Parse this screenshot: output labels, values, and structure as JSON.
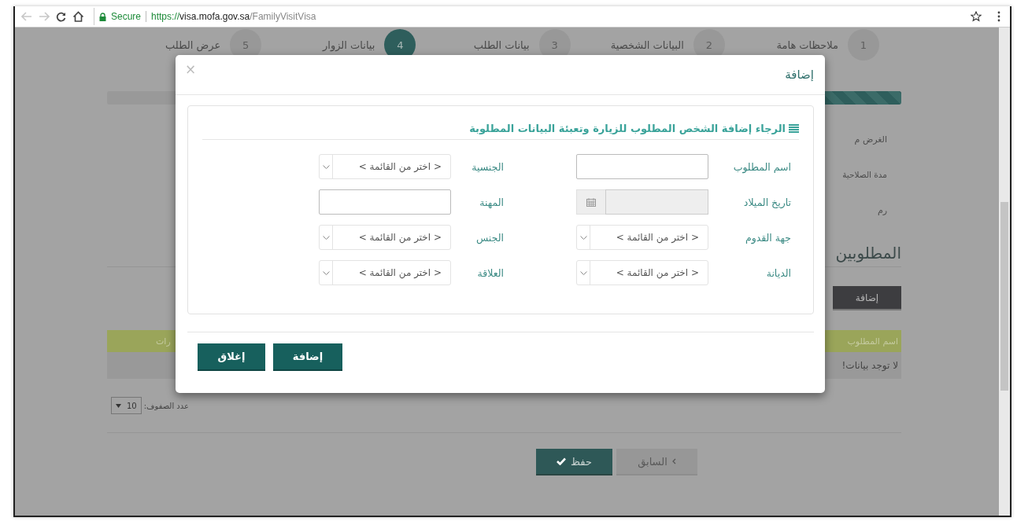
{
  "browser": {
    "secure_label": "Secure",
    "url": {
      "scheme": "https://",
      "host": "visa.mofa.gov.sa",
      "path": "/FamilyVisitVisa"
    }
  },
  "steps": [
    {
      "number": "1",
      "label": "ملاحظات هامة",
      "selected": false
    },
    {
      "number": "2",
      "label": "البيانات الشخصية",
      "selected": false
    },
    {
      "number": "3",
      "label": "بيانات الطلب",
      "selected": false
    },
    {
      "number": "4",
      "label": "بيانات الزوار",
      "selected": true
    },
    {
      "number": "5",
      "label": "عرض الطلب",
      "selected": false
    }
  ],
  "progress": {
    "level": 0.8
  },
  "info_lines": [
    "الغرض م",
    "مدة الصلاحية",
    "رم"
  ],
  "section_title": "المطلوبين",
  "add_button": "إضافة",
  "table": {
    "columns": [
      "اسم المطلوب",
      "رات"
    ],
    "empty_message": "لا توجد بيانات!"
  },
  "page_size": {
    "label": "عدد الصفوف:",
    "value": "10"
  },
  "actions": [
    {
      "label": "السابق",
      "kind": "back"
    },
    {
      "label": "حفظ",
      "kind": "primary"
    }
  ],
  "modal": {
    "title": "إضافة",
    "close": "×",
    "panel_title": "الرجاء إضافة الشخص المطلوب للزيارة وتعبئة البيانات المطلوبة",
    "fields": [
      {
        "label": "اسم المطلوب",
        "kind": "text"
      },
      {
        "label": "الجنسية",
        "kind": "select",
        "placeholder": "< اختر من القائمة >"
      },
      {
        "label": "تاريخ الميلاد",
        "kind": "date"
      },
      {
        "label": "المهنة",
        "kind": "text"
      },
      {
        "label": "جهة القدوم",
        "kind": "select",
        "placeholder": "< اختر من القائمة >"
      },
      {
        "label": "الجنس",
        "kind": "select",
        "placeholder": "< اختر من القائمة >"
      },
      {
        "label": "الديانة",
        "kind": "select",
        "placeholder": "< اختر من القائمة >"
      },
      {
        "label": "العلاقة",
        "kind": "select",
        "placeholder": "< اختر من القائمة >"
      }
    ],
    "buttons": [
      "إضافة",
      "إغلاق"
    ]
  }
}
